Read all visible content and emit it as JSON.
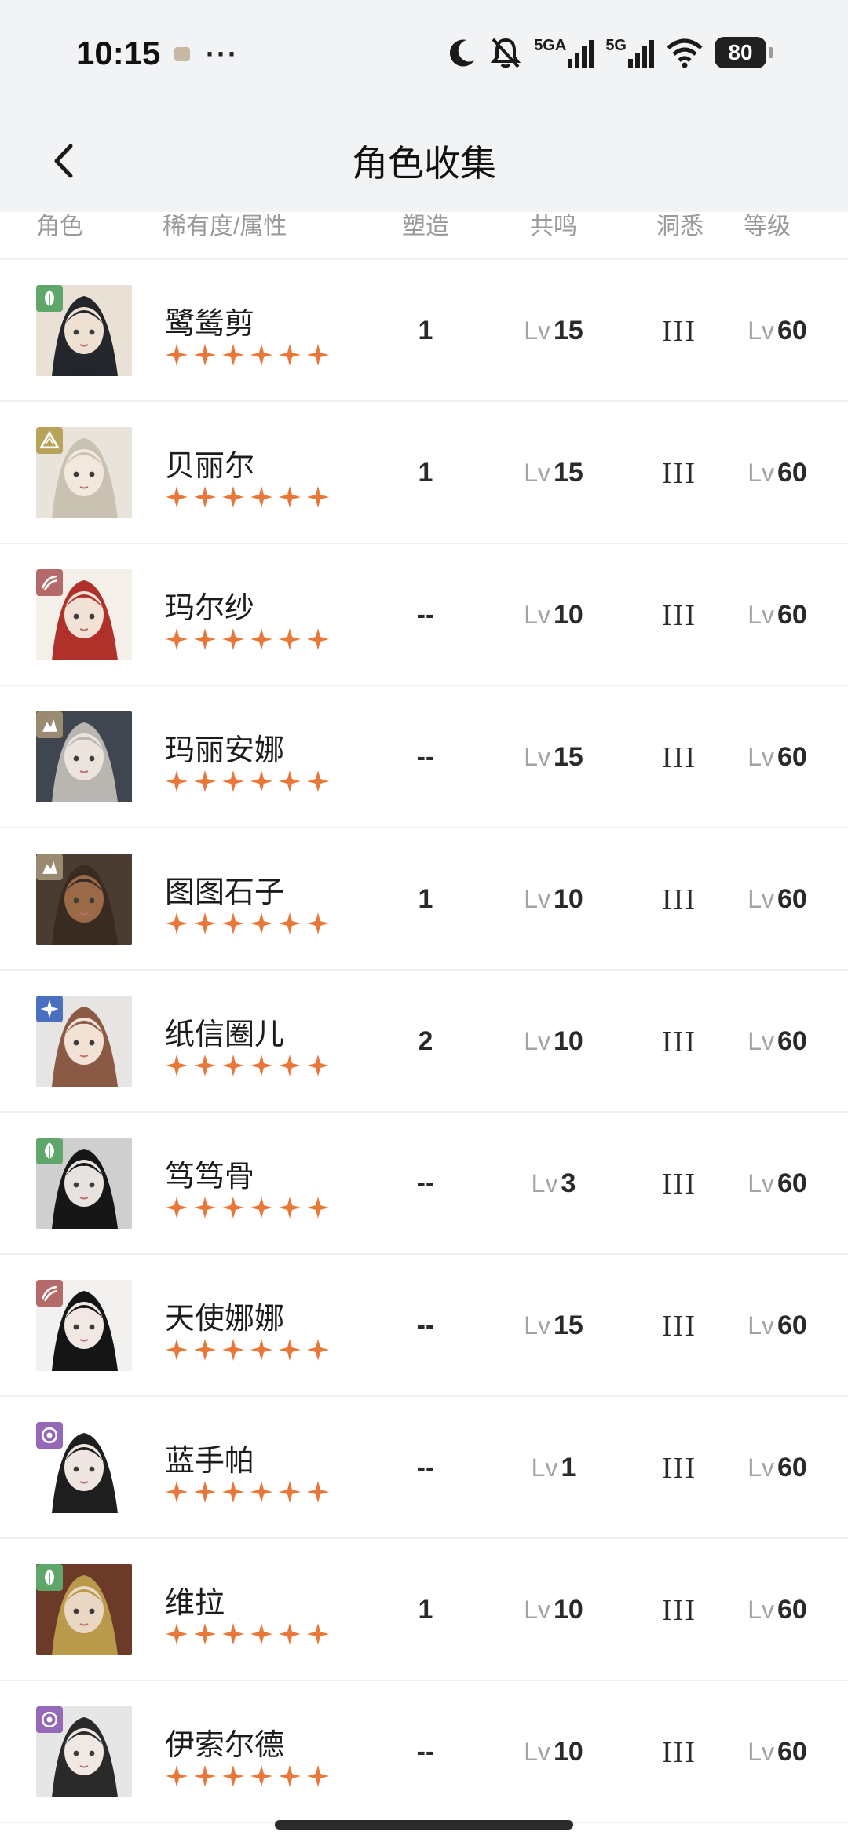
{
  "status": {
    "time": "10:15",
    "dots": "···",
    "net1": "5GA",
    "net2": "5G",
    "battery": "80"
  },
  "header": {
    "title": "角色收集"
  },
  "columns": {
    "role": "角色",
    "rarity": "稀有度/属性",
    "mold": "塑造",
    "resonance": "共鸣",
    "insight": "洞悉",
    "level": "等级"
  },
  "colors": {
    "star": "#e8783a",
    "plant": "#5fa66a",
    "rock": "#b8a35a",
    "beast": "#b56a6a",
    "mineral": "#9b8a72",
    "star_attr": "#4a6fc0",
    "spirit": "#9568b8"
  },
  "characters": [
    {
      "name": "鹭鸶剪",
      "rarity": 6,
      "attribute": "plant",
      "mold": "1",
      "res_prefix": "Lv",
      "res": "15",
      "insight": "III",
      "lv_prefix": "Lv",
      "level": "60",
      "hair": "#23262a",
      "skin": "#efe0d4",
      "bg": "#e9e1d6"
    },
    {
      "name": "贝丽尔",
      "rarity": 6,
      "attribute": "rock",
      "mold": "1",
      "res_prefix": "Lv",
      "res": "15",
      "insight": "III",
      "lv_prefix": "Lv",
      "level": "60",
      "hair": "#c9c2b2",
      "skin": "#f3e8dd",
      "bg": "#e8e4dc"
    },
    {
      "name": "玛尔纱",
      "rarity": 6,
      "attribute": "beast",
      "mold": "--",
      "res_prefix": "Lv",
      "res": "10",
      "insight": "III",
      "lv_prefix": "Lv",
      "level": "60",
      "hair": "#b0312a",
      "skin": "#f2e2d6",
      "bg": "#f4efe9"
    },
    {
      "name": "玛丽安娜",
      "rarity": 6,
      "attribute": "mineral",
      "mold": "--",
      "res_prefix": "Lv",
      "res": "15",
      "insight": "III",
      "lv_prefix": "Lv",
      "level": "60",
      "hair": "#b9b6b2",
      "skin": "#ece3dc",
      "bg": "#3f4650"
    },
    {
      "name": "图图石子",
      "rarity": 6,
      "attribute": "mineral",
      "mold": "1",
      "res_prefix": "Lv",
      "res": "10",
      "insight": "III",
      "lv_prefix": "Lv",
      "level": "60",
      "hair": "#3a2b22",
      "skin": "#9a6a47",
      "bg": "#4a3c30"
    },
    {
      "name": "纸信圈儿",
      "rarity": 6,
      "attribute": "star_attr",
      "mold": "2",
      "res_prefix": "Lv",
      "res": "10",
      "insight": "III",
      "lv_prefix": "Lv",
      "level": "60",
      "hair": "#8a5a44",
      "skin": "#f1e2d5",
      "bg": "#e7e5e3"
    },
    {
      "name": "笃笃骨",
      "rarity": 6,
      "attribute": "plant",
      "mold": "--",
      "res_prefix": "Lv",
      "res": "3",
      "insight": "III",
      "lv_prefix": "Lv",
      "level": "60",
      "hair": "#161616",
      "skin": "#e9e3df",
      "bg": "#cfcfd0"
    },
    {
      "name": "天使娜娜",
      "rarity": 6,
      "attribute": "beast",
      "mold": "--",
      "res_prefix": "Lv",
      "res": "15",
      "insight": "III",
      "lv_prefix": "Lv",
      "level": "60",
      "hair": "#151515",
      "skin": "#f1e8e3",
      "bg": "#f3f1ef"
    },
    {
      "name": "蓝手帕",
      "rarity": 6,
      "attribute": "spirit",
      "mold": "--",
      "res_prefix": "Lv",
      "res": "1",
      "insight": "III",
      "lv_prefix": "Lv",
      "level": "60",
      "hair": "#1e1e1e",
      "skin": "#efe6e2",
      "bg": "#ffffff"
    },
    {
      "name": "维拉",
      "rarity": 6,
      "attribute": "plant",
      "mold": "1",
      "res_prefix": "Lv",
      "res": "10",
      "insight": "III",
      "lv_prefix": "Lv",
      "level": "60",
      "hair": "#b89a4a",
      "skin": "#e9d7c4",
      "bg": "#6b3a28"
    },
    {
      "name": "伊索尔德",
      "rarity": 6,
      "attribute": "spirit",
      "mold": "--",
      "res_prefix": "Lv",
      "res": "10",
      "insight": "III",
      "lv_prefix": "Lv",
      "level": "60",
      "hair": "#2a2a2a",
      "skin": "#efe8e3",
      "bg": "#e6e6e6"
    }
  ]
}
